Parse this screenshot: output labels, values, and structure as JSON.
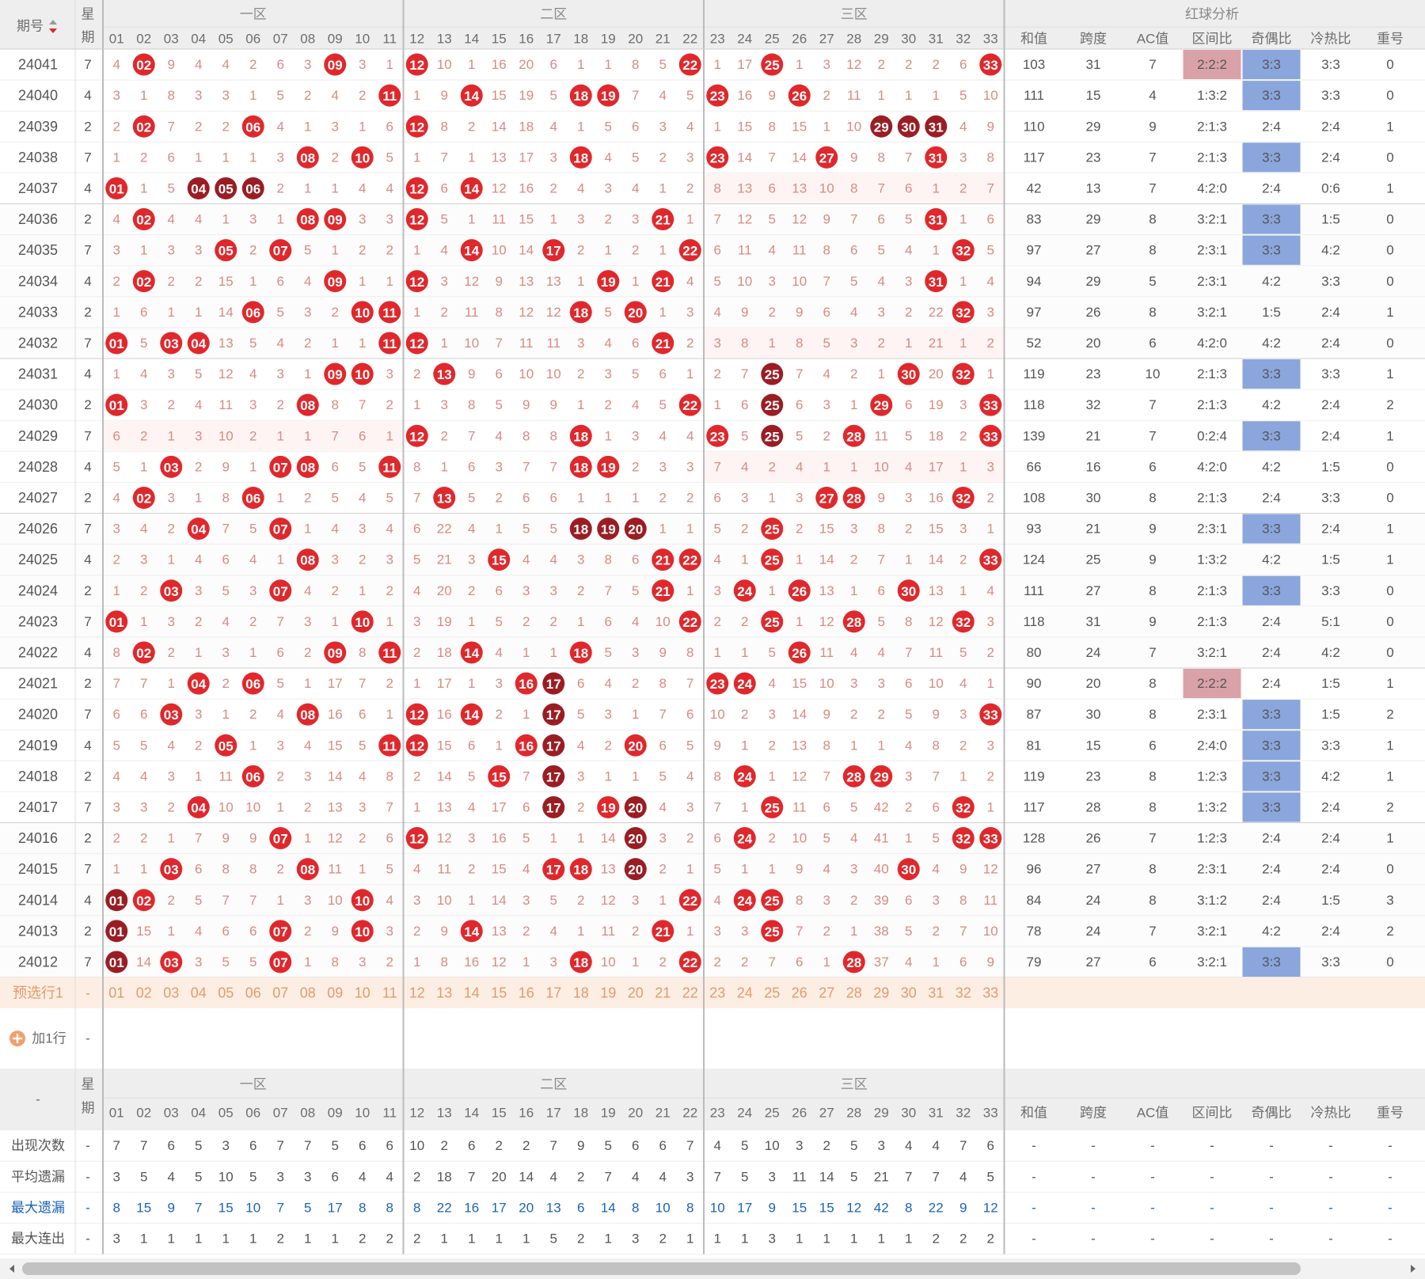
{
  "header": {
    "issue_label": "期号",
    "week_label_top": "星",
    "week_label_bottom": "期",
    "zones": [
      "一区",
      "二区",
      "三区"
    ],
    "analysis_title": "红球分析",
    "analysis_cols": [
      "和值",
      "跨度",
      "AC值",
      "区间比",
      "奇偶比",
      "冷热比",
      "重号"
    ],
    "numbers": [
      "01",
      "02",
      "03",
      "04",
      "05",
      "06",
      "07",
      "08",
      "09",
      "10",
      "11",
      "12",
      "13",
      "14",
      "15",
      "16",
      "17",
      "18",
      "19",
      "20",
      "21",
      "22",
      "23",
      "24",
      "25",
      "26",
      "27",
      "28",
      "29",
      "30",
      "31",
      "32",
      "33"
    ]
  },
  "colors": {
    "ball_red": "#e0282c",
    "ball_dark": "#9b1d24",
    "ratio_highlight": "#8aa6dc",
    "ratio_pink": "#d9a2a8",
    "row_bg_alt": "#fff4f4",
    "preselect_bg": "#fdeee4"
  },
  "rows": [
    {
      "issue": "24041",
      "week": "7",
      "cells": "4,R02,9,4,4,2,6,3,R09,3,1,R12,10,1,16,20,6,1,1,8,5,R22,1,17,R25,1,3,12,2,2,2,6,R33",
      "sum": "103",
      "span": "31",
      "ac": "7",
      "zone_ratio": "2:2:2",
      "odd_even": "3:3",
      "hot_cold": "3:3",
      "repeat": "0"
    },
    {
      "issue": "24040",
      "week": "4",
      "cells": "3,1,8,3,3,1,5,2,4,2,R11,1,9,R14,15,19,5,R18,R19,7,4,5,R23,16,9,R26,2,11,1,1,1,5,10",
      "sum": "111",
      "span": "15",
      "ac": "4",
      "zone_ratio": "1:3:2",
      "odd_even": "3:3",
      "hot_cold": "3:3",
      "repeat": "0"
    },
    {
      "issue": "24039",
      "week": "2",
      "cells": "2,R02,7,2,2,R06,4,1,3,1,6,R12,8,2,14,18,4,1,5,6,3,4,1,15,8,15,1,10,D29,D30,D31,4,9",
      "sum": "110",
      "span": "29",
      "ac": "9",
      "zone_ratio": "2:1:3",
      "odd_even": "2:4",
      "hot_cold": "2:4",
      "repeat": "1"
    },
    {
      "issue": "24038",
      "week": "7",
      "cells": "1,2,6,1,1,1,3,R08,2,R10,5,1,7,1,13,17,3,R18,4,5,2,3,R23,14,7,14,R27,9,8,7,R31,3,8",
      "sum": "117",
      "span": "23",
      "ac": "7",
      "zone_ratio": "2:1:3",
      "odd_even": "3:3",
      "hot_cold": "2:4",
      "repeat": "0"
    },
    {
      "issue": "24037",
      "week": "4",
      "cells": "R01,1,5,D04,D05,D06,2,1,1,4,4,R12,6,R14,12,16,2,4,3,4,1,2,8,13,6,13,10,8,7,6,1,2,7",
      "sum": "42",
      "span": "13",
      "ac": "7",
      "zone_ratio": "4:2:0",
      "odd_even": "2:4",
      "hot_cold": "0:6",
      "repeat": "1"
    },
    {
      "issue": "24036",
      "week": "2",
      "cells": "4,R02,4,4,1,3,1,R08,R09,3,3,R12,5,1,11,15,1,3,2,3,R21,1,7,12,5,12,9,7,6,5,R31,1,6",
      "sum": "83",
      "span": "29",
      "ac": "8",
      "zone_ratio": "3:2:1",
      "odd_even": "3:3",
      "hot_cold": "1:5",
      "repeat": "0"
    },
    {
      "issue": "24035",
      "week": "7",
      "cells": "3,1,3,3,R05,2,R07,5,1,2,2,1,4,R14,10,14,R17,2,1,2,1,R22,6,11,4,11,8,6,5,4,1,R32,5",
      "sum": "97",
      "span": "27",
      "ac": "8",
      "zone_ratio": "2:3:1",
      "odd_even": "3:3",
      "hot_cold": "4:2",
      "repeat": "0"
    },
    {
      "issue": "24034",
      "week": "4",
      "cells": "2,R02,2,2,15,1,6,4,R09,1,1,R12,3,12,9,13,13,1,R19,1,R21,4,5,10,3,10,7,5,4,3,R31,1,4",
      "sum": "94",
      "span": "29",
      "ac": "5",
      "zone_ratio": "2:3:1",
      "odd_even": "4:2",
      "hot_cold": "3:3",
      "repeat": "0"
    },
    {
      "issue": "24033",
      "week": "2",
      "cells": "1,6,1,1,14,R06,5,3,2,R10,R11,1,2,11,8,12,12,R18,5,R20,1,3,4,9,2,9,6,4,3,2,22,R32,3",
      "sum": "97",
      "span": "26",
      "ac": "8",
      "zone_ratio": "3:2:1",
      "odd_even": "1:5",
      "hot_cold": "2:4",
      "repeat": "1"
    },
    {
      "issue": "24032",
      "week": "7",
      "cells": "R01,5,R03,R04,13,5,4,2,1,1,R11,R12,1,10,7,11,11,3,4,6,R21,2,3,8,1,8,5,3,2,1,21,1,2",
      "sum": "52",
      "span": "20",
      "ac": "6",
      "zone_ratio": "4:2:0",
      "odd_even": "4:2",
      "hot_cold": "2:4",
      "repeat": "0"
    },
    {
      "issue": "24031",
      "week": "4",
      "cells": "1,4,3,5,12,4,3,1,R09,R10,3,2,R13,9,6,10,10,2,3,5,6,1,2,7,D25,7,4,2,1,R30,20,R32,1",
      "sum": "119",
      "span": "23",
      "ac": "10",
      "zone_ratio": "2:1:3",
      "odd_even": "3:3",
      "hot_cold": "3:3",
      "repeat": "1"
    },
    {
      "issue": "24030",
      "week": "2",
      "cells": "R01,3,2,4,11,3,2,R08,8,7,2,1,3,8,5,9,9,1,2,4,5,R22,1,6,D25,6,3,1,R29,6,19,3,R33",
      "sum": "118",
      "span": "32",
      "ac": "7",
      "zone_ratio": "2:1:3",
      "odd_even": "4:2",
      "hot_cold": "2:4",
      "repeat": "2"
    },
    {
      "issue": "24029",
      "week": "7",
      "cells": "6,2,1,3,10,2,1,1,7,6,1,R12,2,7,4,8,8,R18,1,3,4,4,R23,5,D25,5,2,R28,11,5,18,2,R33",
      "sum": "139",
      "span": "21",
      "ac": "7",
      "zone_ratio": "0:2:4",
      "odd_even": "3:3",
      "hot_cold": "2:4",
      "repeat": "1"
    },
    {
      "issue": "24028",
      "week": "4",
      "cells": "5,1,R03,2,9,1,R07,R08,6,5,R11,8,1,6,3,7,7,R18,R19,2,3,3,7,4,2,4,1,1,10,4,17,1,3",
      "sum": "66",
      "span": "16",
      "ac": "6",
      "zone_ratio": "4:2:0",
      "odd_even": "4:2",
      "hot_cold": "1:5",
      "repeat": "0"
    },
    {
      "issue": "24027",
      "week": "2",
      "cells": "4,R02,3,1,8,R06,1,2,5,4,5,7,R13,5,2,6,6,1,1,1,2,2,6,3,1,3,R27,R28,9,3,16,R32,2",
      "sum": "108",
      "span": "30",
      "ac": "8",
      "zone_ratio": "2:1:3",
      "odd_even": "2:4",
      "hot_cold": "3:3",
      "repeat": "0"
    },
    {
      "issue": "24026",
      "week": "7",
      "cells": "3,4,2,R04,7,5,R07,1,4,3,4,6,22,4,1,5,5,D18,D19,D20,1,1,5,2,R25,2,15,3,8,2,15,3,1",
      "sum": "93",
      "span": "21",
      "ac": "9",
      "zone_ratio": "2:3:1",
      "odd_even": "3:3",
      "hot_cold": "2:4",
      "repeat": "1"
    },
    {
      "issue": "24025",
      "week": "4",
      "cells": "2,3,1,4,6,4,1,R08,3,2,3,5,21,3,R15,4,4,3,8,6,R21,R22,4,1,R25,1,14,2,7,1,14,2,R33",
      "sum": "124",
      "span": "25",
      "ac": "9",
      "zone_ratio": "1:3:2",
      "odd_even": "4:2",
      "hot_cold": "1:5",
      "repeat": "1"
    },
    {
      "issue": "24024",
      "week": "2",
      "cells": "1,2,R03,3,5,3,R07,4,2,1,2,4,20,2,6,3,3,2,7,5,R21,1,3,R24,1,R26,13,1,6,R30,13,1,4",
      "sum": "111",
      "span": "27",
      "ac": "8",
      "zone_ratio": "2:1:3",
      "odd_even": "3:3",
      "hot_cold": "3:3",
      "repeat": "0"
    },
    {
      "issue": "24023",
      "week": "7",
      "cells": "R01,1,3,2,4,2,7,3,1,R10,1,3,19,1,5,2,2,1,6,4,10,R22,2,2,R25,1,12,R28,5,8,12,R32,3",
      "sum": "118",
      "span": "31",
      "ac": "9",
      "zone_ratio": "2:1:3",
      "odd_even": "2:4",
      "hot_cold": "5:1",
      "repeat": "0"
    },
    {
      "issue": "24022",
      "week": "4",
      "cells": "8,R02,2,1,3,1,6,2,R09,8,R11,2,18,R14,4,1,1,R18,5,3,9,8,1,1,5,R26,11,4,4,7,11,5,2",
      "sum": "80",
      "span": "24",
      "ac": "7",
      "zone_ratio": "3:2:1",
      "odd_even": "2:4",
      "hot_cold": "4:2",
      "repeat": "0"
    },
    {
      "issue": "24021",
      "week": "2",
      "cells": "7,7,1,R04,2,R06,5,1,17,7,2,1,17,1,3,R16,D17,6,4,2,8,7,R23,R24,4,15,10,3,3,6,10,4,1",
      "sum": "90",
      "span": "20",
      "ac": "8",
      "zone_ratio": "2:2:2",
      "odd_even": "2:4",
      "hot_cold": "1:5",
      "repeat": "1"
    },
    {
      "issue": "24020",
      "week": "7",
      "cells": "6,6,R03,3,1,2,4,R08,16,6,1,R12,16,R14,2,1,D17,5,3,1,7,6,10,2,3,14,9,2,2,5,9,3,R33",
      "sum": "87",
      "span": "30",
      "ac": "8",
      "zone_ratio": "2:3:1",
      "odd_even": "3:3",
      "hot_cold": "1:5",
      "repeat": "2"
    },
    {
      "issue": "24019",
      "week": "4",
      "cells": "5,5,4,2,R05,1,3,4,15,5,R11,R12,15,6,1,R16,D17,4,2,R20,6,5,9,1,2,13,8,1,1,4,8,2,3",
      "sum": "81",
      "span": "15",
      "ac": "6",
      "zone_ratio": "2:4:0",
      "odd_even": "3:3",
      "hot_cold": "3:3",
      "repeat": "1"
    },
    {
      "issue": "24018",
      "week": "2",
      "cells": "4,4,3,1,11,R06,2,3,14,4,8,2,14,5,R15,7,D17,3,1,1,5,4,8,R24,1,12,7,R28,R29,3,7,1,2",
      "sum": "119",
      "span": "23",
      "ac": "8",
      "zone_ratio": "1:2:3",
      "odd_even": "3:3",
      "hot_cold": "4:2",
      "repeat": "1"
    },
    {
      "issue": "24017",
      "week": "7",
      "cells": "3,3,2,R04,10,10,1,2,13,3,7,1,13,4,17,6,D17,2,R19,D20,4,3,7,1,R25,11,6,5,42,2,6,R32,1",
      "sum": "117",
      "span": "28",
      "ac": "8",
      "zone_ratio": "1:3:2",
      "odd_even": "3:3",
      "hot_cold": "2:4",
      "repeat": "2"
    },
    {
      "issue": "24016",
      "week": "2",
      "cells": "2,2,1,7,9,9,R07,1,12,2,6,R12,12,3,16,5,1,1,14,D20,3,2,6,R24,2,10,5,4,41,1,5,R32,R33",
      "sum": "128",
      "span": "26",
      "ac": "7",
      "zone_ratio": "1:2:3",
      "odd_even": "2:4",
      "hot_cold": "2:4",
      "repeat": "1"
    },
    {
      "issue": "24015",
      "week": "7",
      "cells": "1,1,R03,6,8,8,2,R08,11,1,5,4,11,2,15,4,R17,R18,13,D20,2,1,5,1,1,9,4,3,40,R30,4,9,12",
      "sum": "96",
      "span": "27",
      "ac": "8",
      "zone_ratio": "2:3:1",
      "odd_even": "2:4",
      "hot_cold": "2:4",
      "repeat": "0"
    },
    {
      "issue": "24014",
      "week": "4",
      "cells": "D01,R02,2,5,7,7,1,3,10,R10,4,3,10,1,14,3,5,2,12,3,1,R22,4,R24,R25,8,3,2,39,6,3,8,11",
      "sum": "84",
      "span": "24",
      "ac": "8",
      "zone_ratio": "3:1:2",
      "odd_even": "2:4",
      "hot_cold": "1:5",
      "repeat": "3"
    },
    {
      "issue": "24013",
      "week": "2",
      "cells": "D01,15,1,4,6,6,R07,2,9,R10,3,2,9,R14,13,2,4,1,11,2,R21,1,3,3,R25,7,2,1,38,5,2,7,10",
      "sum": "78",
      "span": "24",
      "ac": "7",
      "zone_ratio": "3:2:1",
      "odd_even": "4:2",
      "hot_cold": "2:4",
      "repeat": "2"
    },
    {
      "issue": "24012",
      "week": "7",
      "cells": "D01,14,R03,3,5,5,R07,1,8,3,2,1,8,16,12,1,3,R18,10,1,2,R22,2,2,7,6,1,R28,37,4,1,6,9",
      "sum": "79",
      "span": "27",
      "ac": "6",
      "zone_ratio": "3:2:1",
      "odd_even": "3:3",
      "hot_cold": "3:3",
      "repeat": "0"
    }
  ],
  "preselect": {
    "label": "预选行1",
    "week": "-"
  },
  "add_row": {
    "label": "加1行",
    "week": "-"
  },
  "footer": {
    "issue_label": "-"
  },
  "stats": [
    {
      "label": "出现次数",
      "values": [
        "7",
        "7",
        "6",
        "5",
        "3",
        "6",
        "7",
        "7",
        "5",
        "6",
        "6",
        "10",
        "2",
        "6",
        "2",
        "2",
        "7",
        "9",
        "5",
        "6",
        "6",
        "7",
        "4",
        "5",
        "10",
        "3",
        "2",
        "5",
        "3",
        "4",
        "4",
        "7",
        "6"
      ]
    },
    {
      "label": "平均遗漏",
      "values": [
        "3",
        "5",
        "4",
        "5",
        "10",
        "5",
        "3",
        "3",
        "6",
        "4",
        "4",
        "2",
        "18",
        "7",
        "20",
        "14",
        "4",
        "2",
        "7",
        "4",
        "4",
        "3",
        "7",
        "5",
        "3",
        "11",
        "14",
        "5",
        "21",
        "7",
        "7",
        "4",
        "5"
      ]
    },
    {
      "label": "最大遗漏",
      "values": [
        "8",
        "15",
        "9",
        "7",
        "15",
        "10",
        "7",
        "5",
        "17",
        "8",
        "8",
        "8",
        "22",
        "16",
        "17",
        "20",
        "13",
        "6",
        "14",
        "8",
        "10",
        "8",
        "10",
        "17",
        "9",
        "15",
        "15",
        "12",
        "42",
        "8",
        "22",
        "9",
        "12"
      ]
    },
    {
      "label": "最大连出",
      "values": [
        "3",
        "1",
        "1",
        "1",
        "1",
        "1",
        "2",
        "1",
        "1",
        "2",
        "2",
        "2",
        "1",
        "1",
        "1",
        "1",
        "5",
        "2",
        "1",
        "3",
        "2",
        "1",
        "1",
        "1",
        "3",
        "1",
        "1",
        "1",
        "1",
        "1",
        "2",
        "2",
        "2"
      ]
    }
  ],
  "stats_dash": "-"
}
